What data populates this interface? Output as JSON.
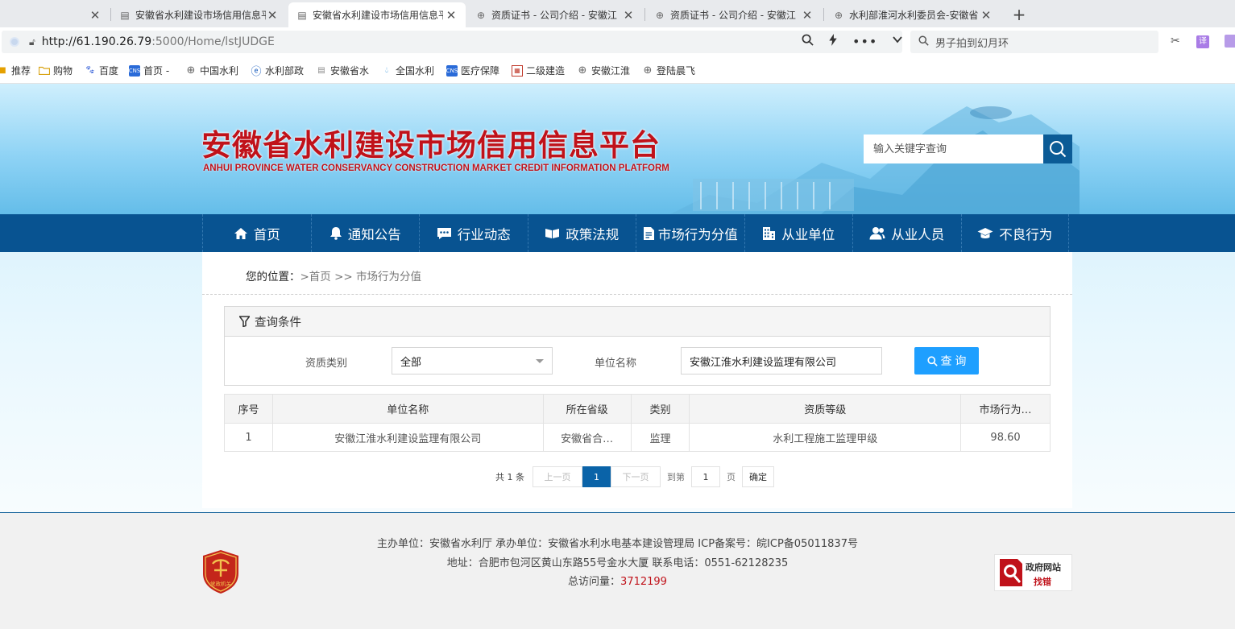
{
  "browser": {
    "tabs": [
      {
        "title": "安徽省水利建设市场信用信息平",
        "active": false
      },
      {
        "title": "安徽省水利建设市场信用信息平",
        "active": true
      },
      {
        "title": "资质证书 - 公司介绍 - 安徽江",
        "active": false
      },
      {
        "title": "资质证书 - 公司介绍 - 安徽江",
        "active": false
      },
      {
        "title": "水利部淮河水利委员会-安徽省",
        "active": false
      }
    ],
    "url_host": "http://61.190.26.79",
    "url_rest": ":5000/Home/lstJUDGE",
    "search_text": "男子拍到幻月环",
    "translate_label": "译",
    "bookmarks": [
      "推荐",
      "购物",
      "百度",
      "首页 -",
      "中国水利",
      "水利部政",
      "安徽省水",
      "全国水利",
      "医疗保障",
      "二级建造",
      "安徽江淮",
      "登陆晨飞"
    ]
  },
  "header": {
    "title": "安徽省水利建设市场信用信息平台",
    "subtitle": "ANHUI PROVINCE WATER CONSERVANCY CONSTRUCTION MARKET CREDIT INFORMATION PLATFORM",
    "search_placeholder": "输入关键字查询"
  },
  "nav": {
    "items": [
      "首页",
      "通知公告",
      "行业动态",
      "政策法规",
      "市场行为分值",
      "从业单位",
      "从业人员",
      "不良行为"
    ]
  },
  "breadcrumb": {
    "label": "您的位置：",
    "path": ">首页 >> 市场行为分值"
  },
  "query": {
    "title": "查询条件",
    "type_label": "资质类别",
    "type_value": "全部",
    "name_label": "单位名称",
    "name_value": "安徽江淮水利建设监理有限公司",
    "button": "查 询"
  },
  "table": {
    "headers": [
      "序号",
      "单位名称",
      "所在省级",
      "类别",
      "资质等级",
      "市场行为…"
    ],
    "rows": [
      [
        "1",
        "安徽江淮水利建设监理有限公司",
        "安徽省合…",
        "监理",
        "水利工程施工监理甲级",
        "98.60"
      ]
    ]
  },
  "pager": {
    "total": "共 1 条",
    "prev": "上一页",
    "current": "1",
    "next": "下一页",
    "goto": "到第",
    "page_value": "1",
    "page_unit": "页",
    "ok": "确定"
  },
  "footer": {
    "line1": "主办单位：安徽省水利厅  承办单位：安徽省水利水电基本建设管理局  ICP备案号：皖ICP备05011837号",
    "line2": "地址：合肥市包河区黄山东路55号金水大厦  联系电话：0551-62128235",
    "visits_label": "总访问量：",
    "visits_value": "3712199",
    "badge_text": "党政机关",
    "gov_line1": "政府网站",
    "gov_line2": "找错"
  },
  "colors": {
    "nav_bg": "#085391",
    "title_red": "#c0121a",
    "query_button": "#1e9fff",
    "pager_active": "#0a63a8"
  }
}
